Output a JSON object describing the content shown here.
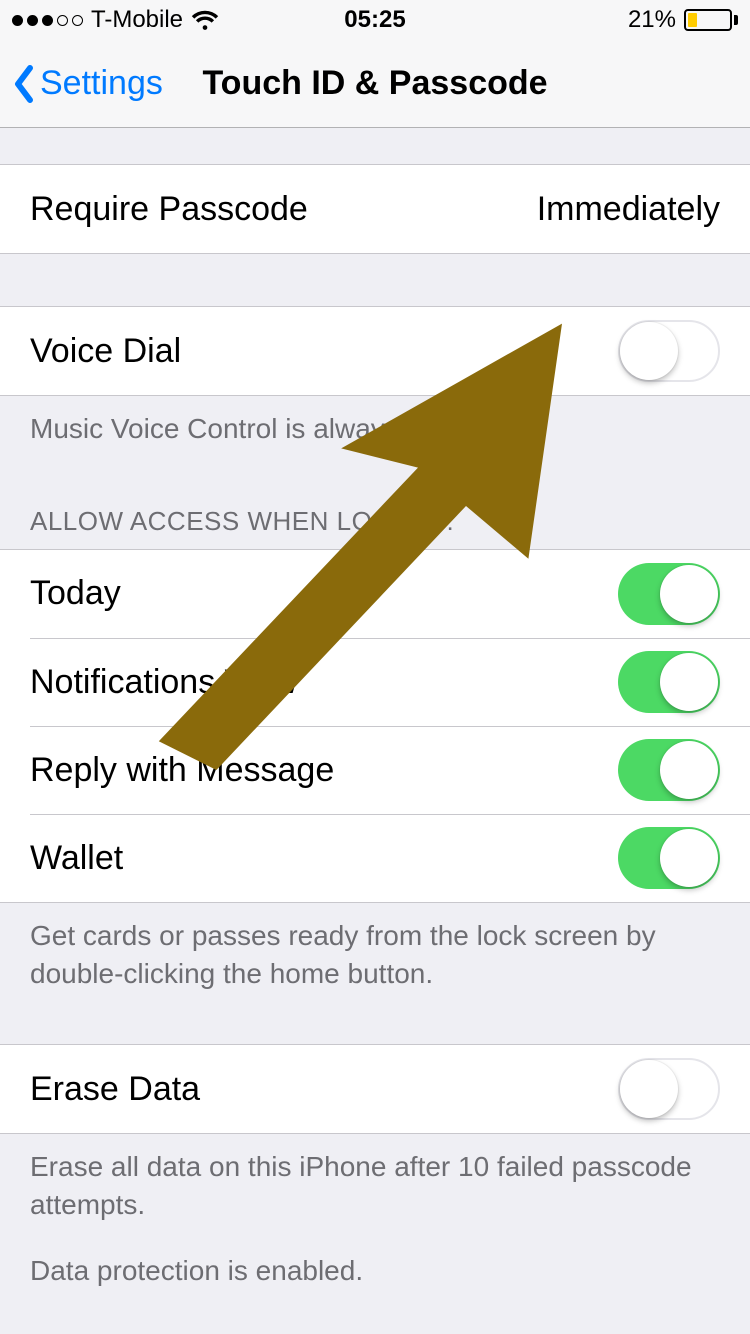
{
  "status": {
    "carrier": "T-Mobile",
    "time": "05:25",
    "battery_pct": "21%",
    "signal_filled": 3,
    "signal_total": 5
  },
  "nav": {
    "back_label": "Settings",
    "title": "Touch ID & Passcode"
  },
  "require_passcode": {
    "label": "Require Passcode",
    "value": "Immediately"
  },
  "voice_dial": {
    "label": "Voice Dial",
    "footer": "Music Voice Control is always enabled.",
    "on": false
  },
  "allow_access": {
    "header": "ALLOW ACCESS WHEN LOCKED:",
    "items": [
      {
        "label": "Today",
        "on": true
      },
      {
        "label": "Notifications View",
        "on": true
      },
      {
        "label": "Reply with Message",
        "on": true
      },
      {
        "label": "Wallet",
        "on": true
      }
    ],
    "footer": "Get cards or passes ready from the lock screen by double-clicking the home button."
  },
  "erase_data": {
    "label": "Erase Data",
    "on": false,
    "footer1": "Erase all data on this iPhone after 10 failed passcode attempts.",
    "footer2": "Data protection is enabled."
  },
  "annotation": {
    "arrow_color": "#8a6a0b"
  }
}
